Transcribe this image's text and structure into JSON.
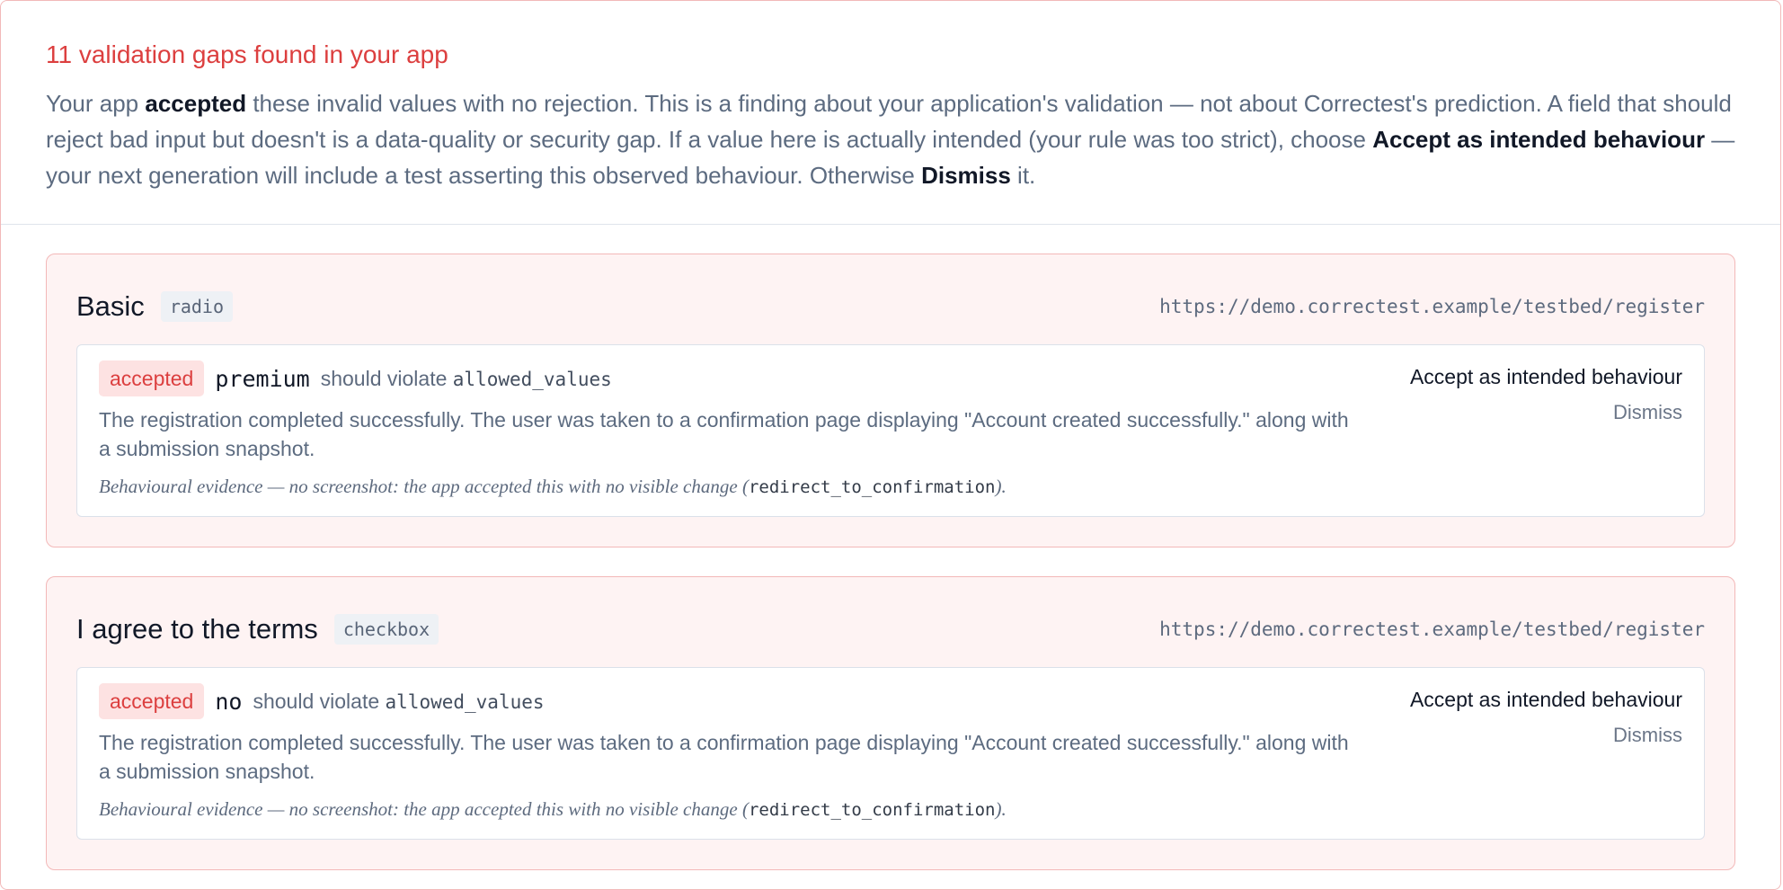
{
  "header": {
    "title": "11 validation gaps found in your app",
    "intro": {
      "p1": "Your app ",
      "accepted": "accepted",
      "p2": " these invalid values with no rejection. This is a finding about your application's validation — not about Correctest's prediction. A field that should reject bad input but doesn't is a data-quality or security gap. If a value here is actually intended (your rule was too strict), choose ",
      "accept_intended": "Accept as intended behaviour",
      "p3": " — your next generation will include a test asserting this observed behaviour. Otherwise ",
      "dismiss": "Dismiss",
      "p4": " it."
    }
  },
  "cards": [
    {
      "field": "Basic",
      "type": "radio",
      "url": "https://demo.correctest.example/testbed/register",
      "status": "accepted",
      "value": "premium",
      "violate_text": "should violate",
      "rule": "allowed_values",
      "description": "The registration completed successfully. The user was taken to a confirmation page displaying \"Account created successfully.\" along with a submission snapshot.",
      "evidence_prefix": "Behavioural evidence — no screenshot: the app accepted this with no visible change (",
      "evidence_code": "redirect_to_confirmation",
      "evidence_suffix": ").",
      "accept_label": "Accept as intended behaviour",
      "dismiss_label": "Dismiss"
    },
    {
      "field": "I agree to the terms",
      "type": "checkbox",
      "url": "https://demo.correctest.example/testbed/register",
      "status": "accepted",
      "value": "no",
      "violate_text": "should violate",
      "rule": "allowed_values",
      "description": "The registration completed successfully. The user was taken to a confirmation page displaying \"Account created successfully.\" along with a submission snapshot.",
      "evidence_prefix": "Behavioural evidence — no screenshot: the app accepted this with no visible change (",
      "evidence_code": "redirect_to_confirmation",
      "evidence_suffix": ").",
      "accept_label": "Accept as intended behaviour",
      "dismiss_label": "Dismiss"
    }
  ]
}
